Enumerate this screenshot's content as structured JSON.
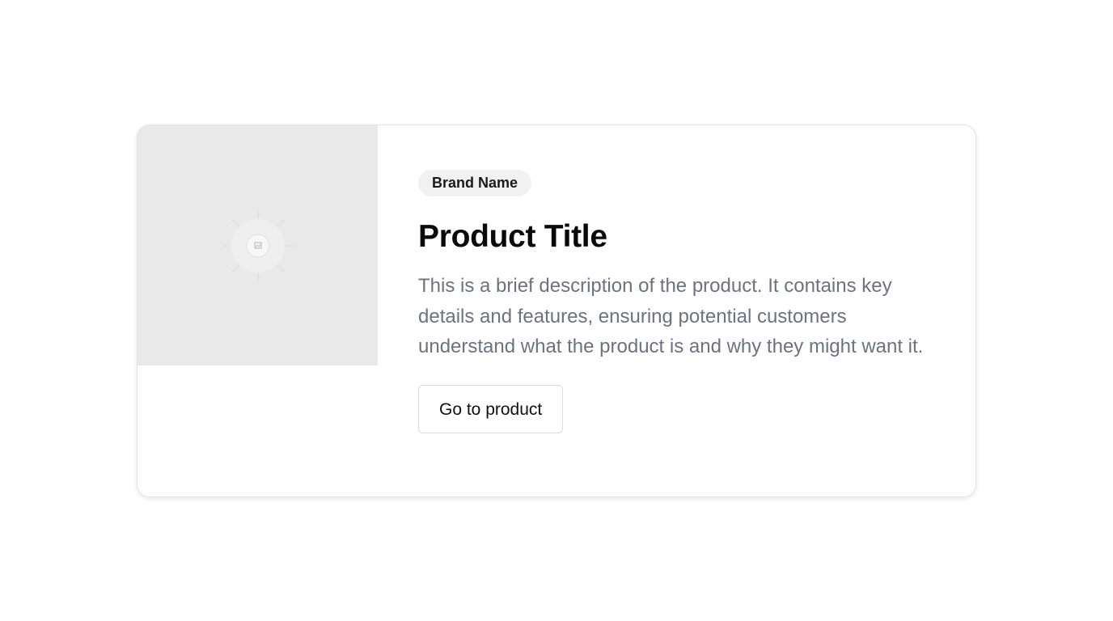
{
  "card": {
    "image": {
      "icon": "image-placeholder-icon",
      "background": "#e9e9e9"
    },
    "brand": "Brand Name",
    "title": "Product Title",
    "description": "This is a brief description of the product. It contains key details and features, ensuring potential customers understand what the product is and why they might want it.",
    "cta_label": "Go to product"
  },
  "colors": {
    "description_text": "#6b7280",
    "badge_background": "#f1f1f1",
    "title_text": "#0a0a0a"
  }
}
